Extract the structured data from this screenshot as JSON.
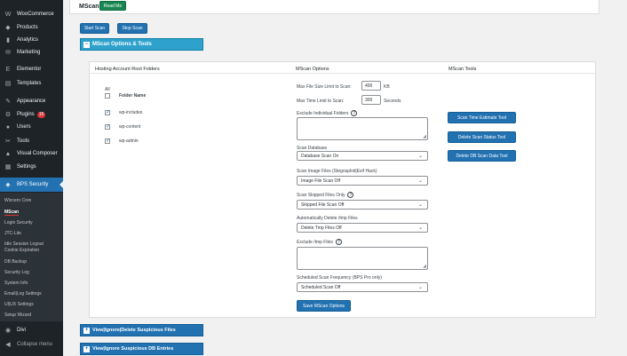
{
  "sidebar": {
    "items": [
      {
        "label": "WooCommerce",
        "icon": "woocommerce-icon",
        "glyph": "W"
      },
      {
        "label": "Products",
        "icon": "products-icon",
        "glyph": "◆"
      },
      {
        "label": "Analytics",
        "icon": "analytics-icon",
        "glyph": "▮"
      },
      {
        "label": "Marketing",
        "icon": "marketing-icon",
        "glyph": "✉"
      },
      {
        "label": "Elementor",
        "icon": "elementor-icon",
        "glyph": "E"
      },
      {
        "label": "Templates",
        "icon": "templates-icon",
        "glyph": "▤"
      },
      {
        "label": "Appearance",
        "icon": "appearance-icon",
        "glyph": "✎"
      },
      {
        "label": "Plugins",
        "icon": "plugins-icon",
        "glyph": "⚙",
        "badge": "15"
      },
      {
        "label": "Users",
        "icon": "users-icon",
        "glyph": "●"
      },
      {
        "label": "Tools",
        "icon": "tools-icon",
        "glyph": "✂"
      },
      {
        "label": "Visual Composer",
        "icon": "visual-composer-icon",
        "glyph": "▲"
      },
      {
        "label": "Settings",
        "icon": "settings-icon",
        "glyph": "▦"
      },
      {
        "label": "BPS Security",
        "icon": "shield-icon",
        "glyph": "◈"
      }
    ],
    "submenu": [
      "Wizcero Core",
      "MScan",
      "Login Security",
      "JTC-Lite",
      "Idle Session Logout",
      "Cookie Expiration",
      "DB Backup",
      "Security Log",
      "System Info",
      "Email|Log Settings",
      "UI|UX Settings",
      "Setup Wizard"
    ],
    "divi": "Divi",
    "collapse": "Collapse menu"
  },
  "header": {
    "title": "MScan",
    "read_me": "Read Me"
  },
  "actions": {
    "start_scan": "Start Scan",
    "stop_scan": "Stop Scan"
  },
  "options_bar": "MScan Options & Tools",
  "panel": {
    "col1_header": "Hosting Account Root Folders",
    "col2_header": "MScan Options",
    "col3_header": "MScan Tools",
    "all_label": "All",
    "folder_name_header": "Folder Name",
    "folders": [
      "wp-includes",
      "wp-content",
      "wp-admin"
    ],
    "max_file_size_label": "Max File Size Limit to Scan:",
    "max_file_size_value": "400",
    "max_file_size_unit": "KB",
    "max_time_label": "Max Time Limit to Scan:",
    "max_time_value": "300",
    "max_time_unit": "Seconds",
    "exclude_folders_label": "Exclude Individual Folders",
    "scan_database_label": "Scan Database",
    "scan_database_value": "Database Scan On",
    "scan_image_label": "Scan Image Files (Stegosploit|Exif Hack)",
    "scan_image_value": "Image File Scan Off",
    "scan_skipped_label": "Scan Skipped Files Only",
    "scan_skipped_value": "Skipped File Scan Off",
    "auto_delete_label": "Automatically Delete /tmp Files",
    "auto_delete_value": "Delete Tmp Files Off",
    "exclude_tmp_label": "Exclude /tmp Files",
    "scheduled_label": "Scheduled Scan Frequency (BPS Pro only)",
    "scheduled_value": "Scheduled Scan Off",
    "save_button": "Save MScan Options",
    "tools": [
      "Scan Time Estimate Tool",
      "Delete Scan Status Tool",
      "Delete DB Scan Data Tool"
    ]
  },
  "bottom_bars": [
    "View|Ignore|Delete Suspicious Files",
    "View|Ignore Suspicious DB Entries"
  ],
  "colors": {
    "admin_bar": "#1d2327",
    "accent": "#2271b1",
    "options_bar": "#2ea2cc",
    "badge": "#d63638"
  }
}
